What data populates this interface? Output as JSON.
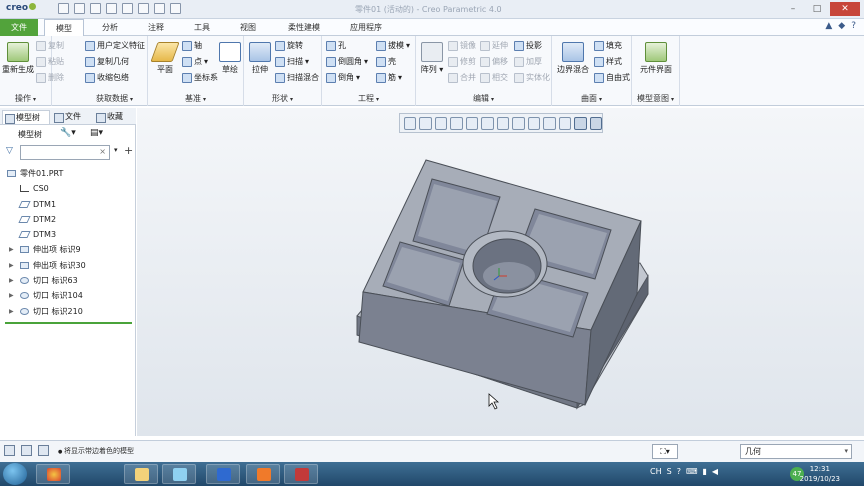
{
  "window": {
    "logo": "creo",
    "title": "零件01 (活动的) - Creo Parametric 4.0"
  },
  "tabs": [
    "文件",
    "模型",
    "分析",
    "注释",
    "工具",
    "视图",
    "柔性建模",
    "应用程序"
  ],
  "ribbon": {
    "operations": {
      "label": "操作",
      "regen": "重新生成",
      "copy": "复制",
      "paste": "粘贴",
      "delete": "删除"
    },
    "get_data": {
      "label": "获取数据",
      "udf": "用户定义特征",
      "copy_geom": "复制几何",
      "shrinkwrap": "收缩包络"
    },
    "datum": {
      "label": "基准",
      "plane": "平面",
      "axis": "轴",
      "point": "点",
      "csys": "坐标系",
      "sketch": "草绘"
    },
    "shapes": {
      "label": "形状",
      "extrude": "拉伸",
      "revolve": "旋转",
      "sweep": "扫描",
      "swept_blend": "扫描混合"
    },
    "engineering": {
      "label": "工程",
      "hole": "孔",
      "round": "倒圆角",
      "chamfer": "倒角",
      "draft": "拔模",
      "shell": "壳",
      "rib": "筋"
    },
    "editing": {
      "label": "编辑",
      "pattern": "阵列",
      "mirror": "镜像",
      "trim": "修剪",
      "merge": "合并",
      "extend": "延伸",
      "offset": "偏移",
      "intersect": "相交",
      "project": "投影",
      "thicken": "加厚",
      "solidify": "实体化"
    },
    "surfaces": {
      "label": "曲面",
      "boundary_blend": "边界混合",
      "fill": "填充",
      "style": "样式",
      "freestyle": "自由式"
    },
    "model_intent": {
      "label": "模型意图",
      "component_interface": "元件界面"
    }
  },
  "left_panel": {
    "tabs": [
      "模型树",
      "文件",
      "收藏"
    ],
    "tree_header": "模型树",
    "filter_placeholder": "",
    "items": [
      {
        "label": "零件01.PRT",
        "icon": "part-icon",
        "expandable": false,
        "indent": 0
      },
      {
        "label": "CS0",
        "icon": "csys-icon",
        "expandable": false,
        "indent": 1
      },
      {
        "label": "DTM1",
        "icon": "datum-plane-icon",
        "expandable": false,
        "indent": 1
      },
      {
        "label": "DTM2",
        "icon": "datum-plane-icon",
        "expandable": false,
        "indent": 1
      },
      {
        "label": "DTM3",
        "icon": "datum-plane-icon",
        "expandable": false,
        "indent": 1
      },
      {
        "label": "伸出项 标识9",
        "icon": "protrusion-icon",
        "expandable": true,
        "indent": 1
      },
      {
        "label": "伸出项 标识30",
        "icon": "protrusion-icon",
        "expandable": true,
        "indent": 1
      },
      {
        "label": "切口 标识63",
        "icon": "cut-icon",
        "expandable": true,
        "indent": 1
      },
      {
        "label": "切口 标识104",
        "icon": "cut-icon",
        "expandable": true,
        "indent": 1
      },
      {
        "label": "切口 标识210",
        "icon": "cut-icon",
        "expandable": true,
        "indent": 1
      }
    ]
  },
  "status": {
    "message": "将显示带边着色的模型",
    "selection_filter": "几何"
  },
  "taskbar": {
    "tray_lang": "CH",
    "badge": "47",
    "time": "12:31",
    "date": "2019/10/23"
  },
  "colors": {
    "file_tab": "#52a33b",
    "model_shade": "#7a8292"
  }
}
